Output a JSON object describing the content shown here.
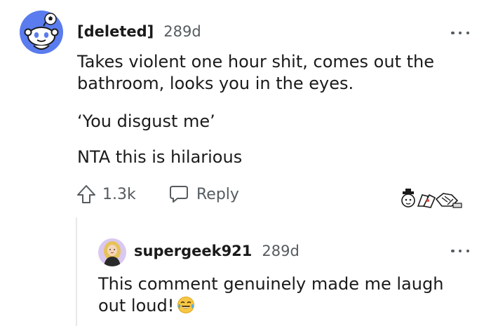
{
  "comment": {
    "username": "[deleted]",
    "age": "289d",
    "paragraphs": [
      "Takes violent one hour shit, comes out the bathroom, looks you in the eyes.",
      "‘You disgust me’",
      "NTA this is hilarious"
    ],
    "upvotes": "1.3k",
    "reply_label": "Reply",
    "avatar_icon": "snoo-soccer-avatar",
    "awards_icon": "award-icons-group"
  },
  "reply": {
    "username": "supergeek921",
    "age": "289d",
    "text": "This comment genuinely made me laugh out loud!",
    "emoji_icon": "laughing-tears-emoji",
    "avatar_icon": "user-avatar"
  },
  "colors": {
    "avatar_bg": "#5a7cef",
    "text": "#1a1a1b",
    "muted": "#555c60",
    "thread_line": "#e8e8e8"
  }
}
